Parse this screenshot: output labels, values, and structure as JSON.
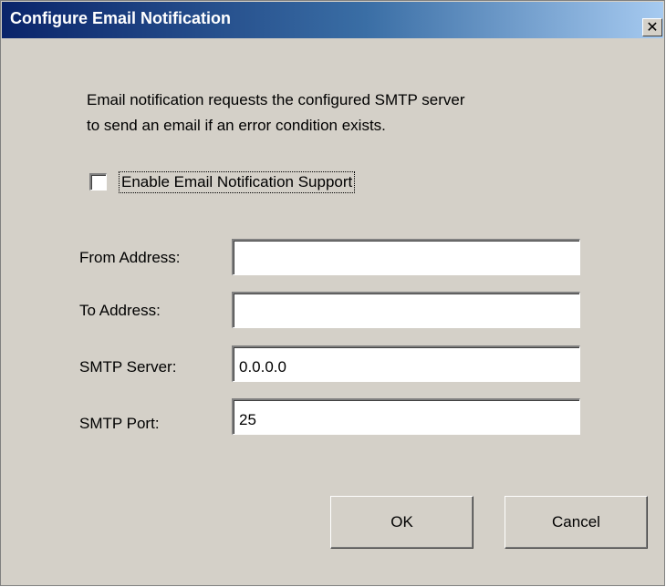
{
  "window": {
    "title": "Configure Email Notification",
    "close_label": "✕"
  },
  "description": "Email notification requests the configured SMTP server\nto send an email if an error condition exists.",
  "checkbox": {
    "label": "Enable Email Notification Support",
    "checked": false
  },
  "fields": {
    "from_address": {
      "label": "From Address:",
      "value": ""
    },
    "to_address": {
      "label": "To Address:",
      "value": ""
    },
    "smtp_server": {
      "label": "SMTP Server:",
      "value": "0.0.0.0"
    },
    "smtp_port": {
      "label": "SMTP Port:",
      "value": "25"
    }
  },
  "buttons": {
    "ok": "OK",
    "cancel": "Cancel"
  },
  "colors": {
    "titlebar_start": "#0a246a",
    "titlebar_end": "#a6caf0",
    "dialog_background": "#d4d0c8"
  }
}
